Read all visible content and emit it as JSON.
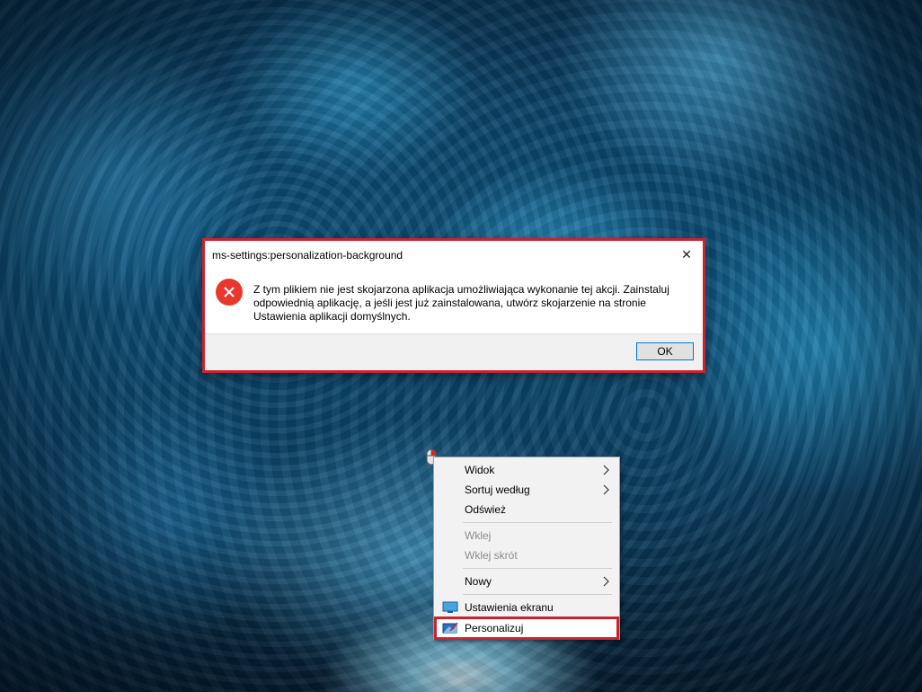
{
  "dialog": {
    "title": "ms-settings:personalization-background",
    "message": "Z tym plikiem nie jest skojarzona aplikacja umożliwiająca wykonanie tej akcji. Zainstaluj odpowiednią aplikację, a jeśli jest już zainstalowana, utwórz skojarzenie na stronie Ustawienia aplikacji domyślnych.",
    "ok_label": "OK",
    "close_glyph": "✕",
    "icon": "error-icon",
    "highlight_color": "#c9232f"
  },
  "context_menu": {
    "items": [
      {
        "label": "Widok",
        "submenu": true,
        "enabled": true
      },
      {
        "label": "Sortuj według",
        "submenu": true,
        "enabled": true
      },
      {
        "label": "Odśwież",
        "submenu": false,
        "enabled": true
      },
      {
        "label": "Wklej",
        "submenu": false,
        "enabled": false
      },
      {
        "label": "Wklej skrót",
        "submenu": false,
        "enabled": false
      },
      {
        "label": "Nowy",
        "submenu": true,
        "enabled": true
      },
      {
        "label": "Ustawienia ekranu",
        "submenu": false,
        "enabled": true,
        "icon": "display-icon"
      },
      {
        "label": "Personalizuj",
        "submenu": false,
        "enabled": true,
        "icon": "personalize-icon",
        "highlighted": true
      }
    ]
  },
  "desktop": {
    "wallpaper": "ice-cave-blue"
  }
}
